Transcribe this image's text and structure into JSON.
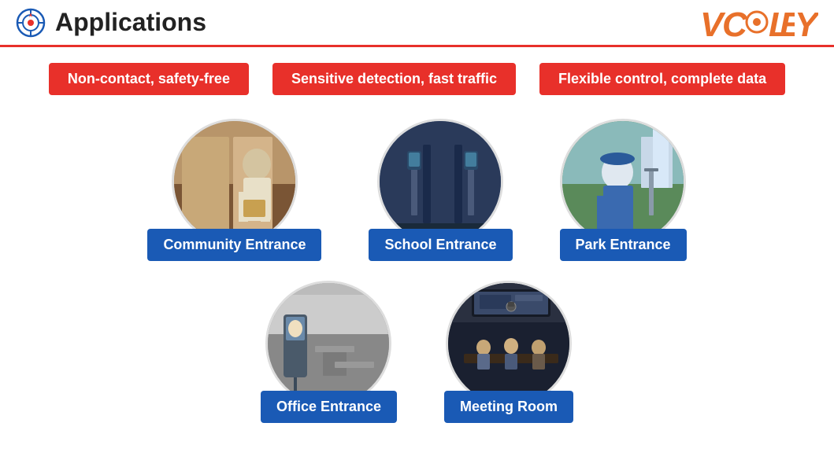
{
  "header": {
    "title": "Applications",
    "icon_name": "compass-target-icon",
    "logo_text": "VCLEY"
  },
  "features": [
    {
      "id": "feature-1",
      "text": "Non-contact, safety-free"
    },
    {
      "id": "feature-2",
      "text": "Sensitive detection, fast traffic"
    },
    {
      "id": "feature-3",
      "text": "Flexible control, complete data"
    }
  ],
  "top_cards": [
    {
      "id": "community",
      "label": "Community Entrance",
      "img_class": "img-community",
      "img_alt": "Person carrying package at community entrance"
    },
    {
      "id": "school",
      "label": "School Entrance",
      "img_class": "img-school",
      "img_alt": "School entrance gate with detection equipment"
    },
    {
      "id": "park",
      "label": "Park Entrance",
      "img_class": "img-park",
      "img_alt": "Park entrance with person in blue shirt"
    }
  ],
  "bottom_cards": [
    {
      "id": "office",
      "label": "Office Entrance",
      "img_class": "img-office",
      "img_alt": "Office interior with detection device"
    },
    {
      "id": "meeting",
      "label": "Meeting Room",
      "img_class": "img-meeting",
      "img_alt": "Meeting room with people around table"
    }
  ]
}
